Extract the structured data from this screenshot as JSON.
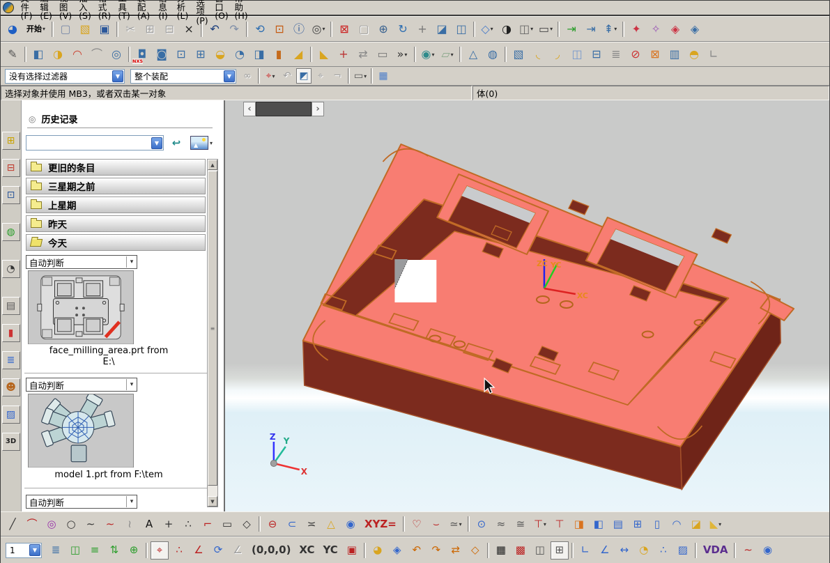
{
  "menu_bar": {
    "items": [
      {
        "n": "file-menu",
        "g": "文件(F)",
        "f": "m"
      },
      {
        "n": "edit-menu",
        "g": "编辑(E)",
        "f": "m"
      },
      {
        "n": "view-menu",
        "g": "视图(V)",
        "f": "m"
      },
      {
        "n": "insert-menu",
        "g": "插入(S)",
        "f": "m"
      },
      {
        "n": "format-menu",
        "g": "格式(R)",
        "f": "m"
      },
      {
        "n": "tools-menu",
        "g": "工具(T)",
        "f": "m"
      },
      {
        "n": "assemblies-menu",
        "g": "装配(A)",
        "f": "m"
      },
      {
        "n": "information-menu",
        "g": "信息(I)",
        "f": "m"
      },
      {
        "n": "analysis-menu",
        "g": "分析(L)",
        "f": "m"
      },
      {
        "n": "preferences-menu",
        "g": "首选项(P)",
        "f": "m"
      },
      {
        "n": "window-menu",
        "g": "窗口(O)",
        "f": "m"
      },
      {
        "n": "help-menu",
        "g": "帮助(H)",
        "f": "m"
      }
    ]
  },
  "toolbars": {
    "standard": [
      {
        "n": "nx-logo-button",
        "g": "◕",
        "c": "#1f5fc4"
      },
      {
        "n": "start-menu-button",
        "g": "开始",
        "f": "td"
      },
      {
        "n": "new-button",
        "g": "▢",
        "c": "#7a8aa8",
        "f": "s"
      },
      {
        "n": "open-button",
        "g": "▧",
        "c": "#d8a520"
      },
      {
        "n": "save-button",
        "g": "▣",
        "c": "#2b579a"
      },
      {
        "n": "cut-button",
        "g": "✂",
        "c": "#888",
        "f": "sx"
      },
      {
        "n": "copy-button",
        "g": "⊞",
        "c": "#888",
        "f": "x"
      },
      {
        "n": "paste-button",
        "g": "⊟",
        "c": "#888",
        "f": "x"
      },
      {
        "n": "delete-button",
        "g": "×",
        "c": "#222"
      },
      {
        "n": "undo-button",
        "g": "↶",
        "c": "#1a3d7c",
        "f": "s"
      },
      {
        "n": "redo-button",
        "g": "↷",
        "c": "#7e8ea8"
      },
      {
        "n": "rotate-object-button",
        "g": "⟲",
        "c": "#2b6cb0",
        "f": "s"
      },
      {
        "n": "resize-window-button",
        "g": "⊡",
        "c": "#c45a11"
      },
      {
        "n": "information-button",
        "g": "ⓘ",
        "c": "#2b579a"
      },
      {
        "n": "find-button",
        "g": "◎",
        "c": "#444",
        "f": "d"
      },
      {
        "n": "fit-view-button",
        "g": "⊠",
        "c": "#cc2222",
        "f": "s"
      },
      {
        "n": "zoom-box-button",
        "g": "▢",
        "c": "#999",
        "f": "x"
      },
      {
        "n": "zoom-button",
        "g": "⊕",
        "c": "#39628f"
      },
      {
        "n": "rotate-view-button",
        "g": "↻",
        "c": "#2b6cb0"
      },
      {
        "n": "pan-button",
        "g": "+",
        "c": "#777"
      },
      {
        "n": "perspective-button",
        "g": "◪",
        "c": "#3a6ea5"
      },
      {
        "n": "snapshot-button",
        "g": "◫",
        "c": "#3a6ea5"
      },
      {
        "n": "isometric-view-button",
        "g": "◇",
        "c": "#4a7cc9",
        "f": "sd"
      },
      {
        "n": "shaded-view-button",
        "g": "◑",
        "c": "#222"
      },
      {
        "n": "view-section-button",
        "g": "◫",
        "c": "#666",
        "f": "d"
      },
      {
        "n": "display-mode-button",
        "g": "▭",
        "c": "#444",
        "f": "d"
      },
      {
        "n": "show-hide-button",
        "g": "⇥",
        "c": "#2a9d2a",
        "f": "s"
      },
      {
        "n": "immediate-hide-button",
        "g": "⇥",
        "c": "#3a6ea5"
      },
      {
        "n": "new-layout-button",
        "g": "⇞",
        "c": "#3a6ea5",
        "f": "d"
      },
      {
        "n": "edit-object-display-button",
        "g": "✦",
        "c": "#cc3344",
        "f": "s"
      },
      {
        "n": "edit-display-settings-button",
        "g": "✧",
        "c": "#9b59b6"
      },
      {
        "n": "datum-plane-red-button",
        "g": "◈",
        "c": "#cc3344"
      },
      {
        "n": "datum-plane-blue-button",
        "g": "◈",
        "c": "#3a6ea5"
      }
    ],
    "feature": [
      {
        "n": "sketch-button",
        "g": "✎",
        "c": "#555"
      },
      {
        "n": "extrude-button",
        "g": "◧",
        "c": "#3a6ea5",
        "f": "s"
      },
      {
        "n": "revolve-button",
        "g": "◑",
        "c": "#d9a520"
      },
      {
        "n": "sweep-along-guide-button",
        "g": "◠",
        "c": "#cc4433"
      },
      {
        "n": "swept-button",
        "g": "⌒",
        "c": "#888"
      },
      {
        "n": "tube-button",
        "g": "◎",
        "c": "#3a6ea5"
      },
      {
        "n": "hole-button",
        "g": "◘",
        "c": "#3a6ea5",
        "f": "s",
        "tag": "NX5"
      },
      {
        "n": "boss-button",
        "g": "◙",
        "c": "#3a6ea5"
      },
      {
        "n": "pocket-button",
        "g": "⊡",
        "c": "#3a6ea5"
      },
      {
        "n": "pad-button",
        "g": "⊞",
        "c": "#3a6ea5"
      },
      {
        "n": "dome-button",
        "g": "◒",
        "c": "#d9a520"
      },
      {
        "n": "emboss-button",
        "g": "◔",
        "c": "#3a6ea5"
      },
      {
        "n": "slot-button",
        "g": "◨",
        "c": "#3a6ea5"
      },
      {
        "n": "thread-button",
        "g": "▮",
        "c": "#c56a1b"
      },
      {
        "n": "draft-button",
        "g": "◢",
        "c": "#d9a520"
      },
      {
        "n": "datum-plane-button",
        "g": "◣",
        "c": "#d9a520",
        "f": "s"
      },
      {
        "n": "point-button",
        "g": "+",
        "c": "#bb3333"
      },
      {
        "n": "offset-face-button",
        "g": "⇄",
        "c": "#888"
      },
      {
        "n": "bounded-plane-button",
        "g": "▭",
        "c": "#777"
      },
      {
        "n": "toolbar-overflow-button",
        "g": "»",
        "c": "#333",
        "f": "d"
      },
      {
        "n": "boolean-button",
        "g": "◉",
        "c": "#2e8b8b",
        "f": "sd"
      },
      {
        "n": "plane-button",
        "g": "▱",
        "c": "#8aa88a",
        "f": "d"
      },
      {
        "n": "point-on-face-button",
        "g": "△",
        "c": "#3a6ea5",
        "f": "s"
      },
      {
        "n": "faceted-sphere-button",
        "g": "◍",
        "c": "#3a6ea5"
      },
      {
        "n": "block-button",
        "g": "▧",
        "c": "#3a6ea5",
        "f": "s"
      },
      {
        "n": "bend-button",
        "g": "◟",
        "c": "#d9a520"
      },
      {
        "n": "flange-button",
        "g": "◞",
        "c": "#d9a520"
      },
      {
        "n": "trim-sheet-button",
        "g": "◫",
        "c": "#7799cc"
      },
      {
        "n": "cavity-button",
        "g": "⊟",
        "c": "#3a6ea5"
      },
      {
        "n": "thread-table-button",
        "g": "≣",
        "c": "#888"
      },
      {
        "n": "split-body-button",
        "g": "⊘",
        "c": "#cc3333"
      },
      {
        "n": "mirror-feature-button",
        "g": "⊠",
        "c": "#d9731f"
      },
      {
        "n": "pattern-feature-button",
        "g": "▥",
        "c": "#3a6ea5"
      },
      {
        "n": "sew-button",
        "g": "◓",
        "c": "#d9a520"
      },
      {
        "n": "patch-button",
        "g": "∟",
        "c": "#888"
      }
    ],
    "selection": [
      {
        "n": "select-scope-button",
        "g": "∞",
        "c": "#999",
        "f": "x"
      },
      {
        "n": "snap-point-button",
        "g": "⌖",
        "c": "#cc3333",
        "f": "sd"
      },
      {
        "n": "undo-selection-button",
        "g": "↶",
        "c": "#999",
        "f": "x"
      },
      {
        "n": "highlight-button",
        "g": "◩",
        "c": "#3a6ea5",
        "f": "p"
      },
      {
        "n": "select-point-button",
        "g": "⌖",
        "c": "#999",
        "f": "x"
      },
      {
        "n": "deselect-button",
        "g": "¬",
        "c": "#999",
        "f": "x"
      },
      {
        "n": "marquee-style-button",
        "g": "▭",
        "c": "#555",
        "f": "sd"
      },
      {
        "n": "shaded-select-button",
        "g": "▦",
        "c": "#4a7cc9",
        "f": "s"
      }
    ],
    "curve": [
      {
        "n": "line-button",
        "g": "╱",
        "c": "#333"
      },
      {
        "n": "arc-button",
        "g": "⌒",
        "c": "#bb2222"
      },
      {
        "n": "circle-center-button",
        "g": "◎",
        "c": "#9933aa"
      },
      {
        "n": "circle-button",
        "g": "○",
        "c": "#333"
      },
      {
        "n": "spline-button",
        "g": "∼",
        "c": "#333"
      },
      {
        "n": "studio-spline-button",
        "g": "∼",
        "c": "#bb2222"
      },
      {
        "n": "curve-fit-button",
        "g": "≀",
        "c": "#888"
      },
      {
        "n": "text-curve-button",
        "g": "A",
        "c": "#111"
      },
      {
        "n": "point-tool-button",
        "g": "+",
        "c": "#333"
      },
      {
        "n": "point-set-button",
        "g": "∴",
        "c": "#333"
      },
      {
        "n": "corner-button",
        "g": "⌐",
        "c": "#bb2222"
      },
      {
        "n": "rectangle-button",
        "g": "▭",
        "c": "#333"
      },
      {
        "n": "polygon-button",
        "g": "◇",
        "c": "#333"
      },
      {
        "n": "ellipse-button",
        "g": "⊖",
        "c": "#bb2222",
        "f": "s"
      },
      {
        "n": "conic-button",
        "g": "⊂",
        "c": "#3366cc"
      },
      {
        "n": "hyperbola-button",
        "g": "≍",
        "c": "#333"
      },
      {
        "n": "helix-cone-button",
        "g": "△",
        "c": "#d9a520"
      },
      {
        "n": "helix-button",
        "g": "◉",
        "c": "#3366cc"
      },
      {
        "n": "law-curve-button",
        "g": "XYZ=",
        "c": "#bb2222",
        "f": "t"
      },
      {
        "n": "offset-curve-button",
        "g": "♡",
        "c": "#bb2222",
        "f": "s"
      },
      {
        "n": "bridge-curve-button",
        "g": "⌣",
        "c": "#bb2222"
      },
      {
        "n": "simplify-curve-button",
        "g": "≃",
        "c": "#555",
        "f": "d"
      },
      {
        "n": "project-curve-button",
        "g": "⊙",
        "c": "#3366cc",
        "f": "s"
      },
      {
        "n": "combined-projection-button",
        "g": "≈",
        "c": "#555"
      },
      {
        "n": "wrap-curve-button",
        "g": "≅",
        "c": "#555"
      },
      {
        "n": "intersection-curve-button",
        "g": "⊤",
        "c": "#bb2222",
        "f": "d"
      },
      {
        "n": "section-curve-button",
        "g": "⊤",
        "c": "#bb2222"
      },
      {
        "n": "extract-curve-button",
        "g": "◨",
        "c": "#d9731f"
      },
      {
        "n": "extract-virtual-curve-button",
        "g": "◧",
        "c": "#3366cc"
      },
      {
        "n": "curves-in-view-button",
        "g": "▤",
        "c": "#3366cc"
      },
      {
        "n": "mirror-curve-button",
        "g": "⊞",
        "c": "#3366cc"
      },
      {
        "n": "offset-in-face-button",
        "g": "▯",
        "c": "#3366cc"
      },
      {
        "n": "wrap-unwrap-button",
        "g": "◠",
        "c": "#3366cc"
      },
      {
        "n": "join-curve-button",
        "g": "◪",
        "c": "#d9a520"
      },
      {
        "n": "more-curves-button",
        "g": "◣",
        "c": "#e0b63a",
        "f": "d"
      }
    ],
    "utility": [
      {
        "n": "layer-settings-button",
        "g": "≣",
        "c": "#3a6ea5"
      },
      {
        "n": "layer-visible-in-view-button",
        "g": "◫",
        "c": "#2a9d2a"
      },
      {
        "n": "move-to-layer-button",
        "g": "≡",
        "c": "#2a9d2a"
      },
      {
        "n": "copy-to-layer-button",
        "g": "⇅",
        "c": "#2a9d2a"
      },
      {
        "n": "layer-category-button",
        "g": "⊕",
        "c": "#2a9d2a"
      },
      {
        "n": "wcs-dynamics-button",
        "g": "⌖",
        "c": "#bb2222",
        "f": "sp"
      },
      {
        "n": "wcs-constructor-button",
        "g": "∴",
        "c": "#bb2222"
      },
      {
        "n": "wcs-origin-button",
        "g": "∠",
        "c": "#bb2222"
      },
      {
        "n": "wcs-rotate-button",
        "g": "⟳",
        "c": "#3366cc"
      },
      {
        "n": "wcs-orient-button",
        "g": "∠",
        "c": "#999",
        "f": "x"
      },
      {
        "n": "wcs-set-absolute-button",
        "g": "(0,0,0)",
        "c": "#333",
        "f": "t"
      },
      {
        "n": "wcs-align-xc-button",
        "g": "XC",
        "c": "#333",
        "f": "t"
      },
      {
        "n": "wcs-align-yc-button",
        "g": "YC",
        "c": "#333",
        "f": "t"
      },
      {
        "n": "wcs-save-button",
        "g": "▣",
        "c": "#bb2222"
      },
      {
        "n": "visualization-preferences-button",
        "g": "◕",
        "c": "#d9a520",
        "f": "s"
      },
      {
        "n": "orient-view-button",
        "g": "◈",
        "c": "#3366cc"
      },
      {
        "n": "rotate-left-view-button",
        "g": "↶",
        "c": "#cc6600"
      },
      {
        "n": "rotate-right-view-button",
        "g": "↷",
        "c": "#cc6600"
      },
      {
        "n": "flip-view-button",
        "g": "⇄",
        "c": "#cc6600"
      },
      {
        "n": "restore-view-button",
        "g": "◇",
        "c": "#cc6600"
      },
      {
        "n": "grid-button",
        "g": "▦",
        "c": "#222",
        "f": "s"
      },
      {
        "n": "reflection-pattern-button",
        "g": "▩",
        "c": "#bb2222"
      },
      {
        "n": "window-layout-button",
        "g": "◫",
        "c": "#555"
      },
      {
        "n": "work-plane-button",
        "g": "⊞",
        "c": "#555",
        "f": "p"
      },
      {
        "n": "measure-distance-button",
        "g": "∟",
        "c": "#3366cc",
        "f": "s"
      },
      {
        "n": "measure-angle-button",
        "g": "∠",
        "c": "#3366cc"
      },
      {
        "n": "measure-length-button",
        "g": "↔",
        "c": "#3366cc"
      },
      {
        "n": "measure-bodies-button",
        "g": "◔",
        "c": "#d9a520"
      },
      {
        "n": "measure-points-button",
        "g": "∴",
        "c": "#3366cc"
      },
      {
        "n": "measure-faces-button",
        "g": "▨",
        "c": "#3366cc"
      },
      {
        "n": "vda-checker-button",
        "g": "VDA",
        "c": "#5b2d8e",
        "f": "st"
      },
      {
        "n": "curve-analysis-button",
        "g": "∼",
        "c": "#bb2222",
        "f": "s"
      },
      {
        "n": "face-analysis-button",
        "g": "◉",
        "c": "#3366cc"
      }
    ]
  },
  "selection_bar": {
    "filter_value": "没有选择过滤器",
    "scope_value": "整个装配"
  },
  "status_bar": {
    "prompt": "选择对象并使用 MB3，或者双击某一对象",
    "selection_info": "体(0)"
  },
  "resource_bar": {
    "items": [
      {
        "n": "assembly-navigator-tab",
        "g": "⊞",
        "c": "#c8a200",
        "f": "v"
      },
      {
        "n": "constraint-navigator-tab",
        "g": "⊟",
        "c": "#c0392b",
        "f": "v"
      },
      {
        "n": "part-navigator-tab",
        "g": "⊡",
        "c": "#2b579a",
        "f": "v"
      },
      {
        "n": "web-browser-tab",
        "g": "◍",
        "c": "#2a9d2a",
        "f": "vg"
      },
      {
        "n": "history-tab",
        "g": "◔",
        "c": "#333333",
        "f": "vg"
      },
      {
        "n": "palettes-tab",
        "g": "▤",
        "c": "#555555",
        "f": "vg"
      },
      {
        "n": "materials-tab",
        "g": "▮",
        "c": "#cc3333",
        "f": "v"
      },
      {
        "n": "visualization-tab",
        "g": "≣",
        "c": "#3366cc",
        "f": "v"
      },
      {
        "n": "roles-tab",
        "g": "☻",
        "c": "#b5651d",
        "f": "v"
      },
      {
        "n": "backgrounds-tab",
        "g": "▨",
        "c": "#3366cc",
        "f": "v"
      },
      {
        "n": "3d-input-tab",
        "g": "3D",
        "c": "#222222",
        "f": "vt"
      }
    ]
  },
  "history_panel": {
    "title": "历史记录",
    "search_value": "",
    "folders": [
      {
        "label": "更旧的条目"
      },
      {
        "label": "三星期之前"
      },
      {
        "label": "上星期"
      },
      {
        "label": "昨天"
      },
      {
        "label": "今天",
        "open": true
      }
    ],
    "sections": [
      {
        "filter_label": "自动判断",
        "caption_line1": "face_milling_area.prt from",
        "caption_line2": "E:\\"
      },
      {
        "filter_label": "自动判断",
        "caption_line1": "model 1.prt from F:\\tem",
        "caption_line2": ""
      },
      {
        "filter_label": "自动判断"
      }
    ]
  },
  "utility_bar": {
    "work_layer_value": "1"
  },
  "viewport": {
    "wcs": {
      "z": "ZC",
      "y": "YC",
      "x": "XC"
    },
    "absolute_triad": {
      "z": "Z",
      "y": "Y",
      "x": "X"
    },
    "pane_slider": {
      "left_arrow": "‹",
      "right_arrow": "›"
    },
    "colors": {
      "body": "#f87d72",
      "cavity": "#7c2b1e",
      "side": "#6f2418",
      "edge": "#c06a25",
      "background_top": "#c9cac9",
      "background_bottom": "#eaf5fa"
    }
  }
}
